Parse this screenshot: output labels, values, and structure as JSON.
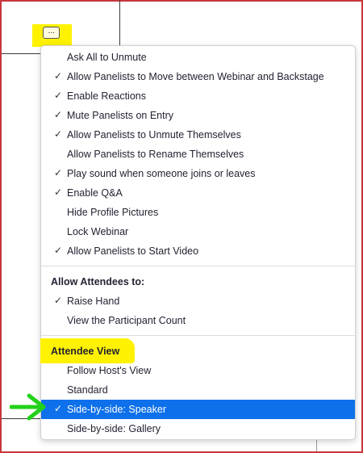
{
  "more_button": {
    "icon": "ellipsis-icon",
    "label": "···"
  },
  "menu": {
    "items": [
      {
        "label": "Ask All to Unmute",
        "checked": false
      },
      {
        "label": "Allow Panelists to Move between Webinar and Backstage",
        "checked": true
      },
      {
        "label": "Enable Reactions",
        "checked": true
      },
      {
        "label": "Mute Panelists on Entry",
        "checked": true
      },
      {
        "label": "Allow Panelists to Unmute Themselves",
        "checked": true
      },
      {
        "label": "Allow Panelists to Rename Themselves",
        "checked": false
      },
      {
        "label": "Play sound when someone joins or leaves",
        "checked": true
      },
      {
        "label": "Enable Q&A",
        "checked": true
      },
      {
        "label": "Hide Profile Pictures",
        "checked": false
      },
      {
        "label": "Lock Webinar",
        "checked": false
      },
      {
        "label": "Allow Panelists to Start Video",
        "checked": true
      }
    ],
    "attendees_section": {
      "header": "Allow Attendees to:",
      "items": [
        {
          "label": "Raise Hand",
          "checked": true
        },
        {
          "label": "View the Participant Count",
          "checked": false
        }
      ]
    },
    "view_section": {
      "header": "Attendee View",
      "items": [
        {
          "label": "Follow Host's View",
          "checked": false
        },
        {
          "label": "Standard",
          "checked": false
        },
        {
          "label": "Side-by-side: Speaker",
          "checked": true,
          "selected": true
        },
        {
          "label": "Side-by-side: Gallery",
          "checked": false
        }
      ]
    }
  },
  "check_glyph": "✓",
  "colors": {
    "highlight": "#fef200",
    "selected": "#0e71eb",
    "arrow": "#22d11a",
    "frame": "#c8373c"
  }
}
